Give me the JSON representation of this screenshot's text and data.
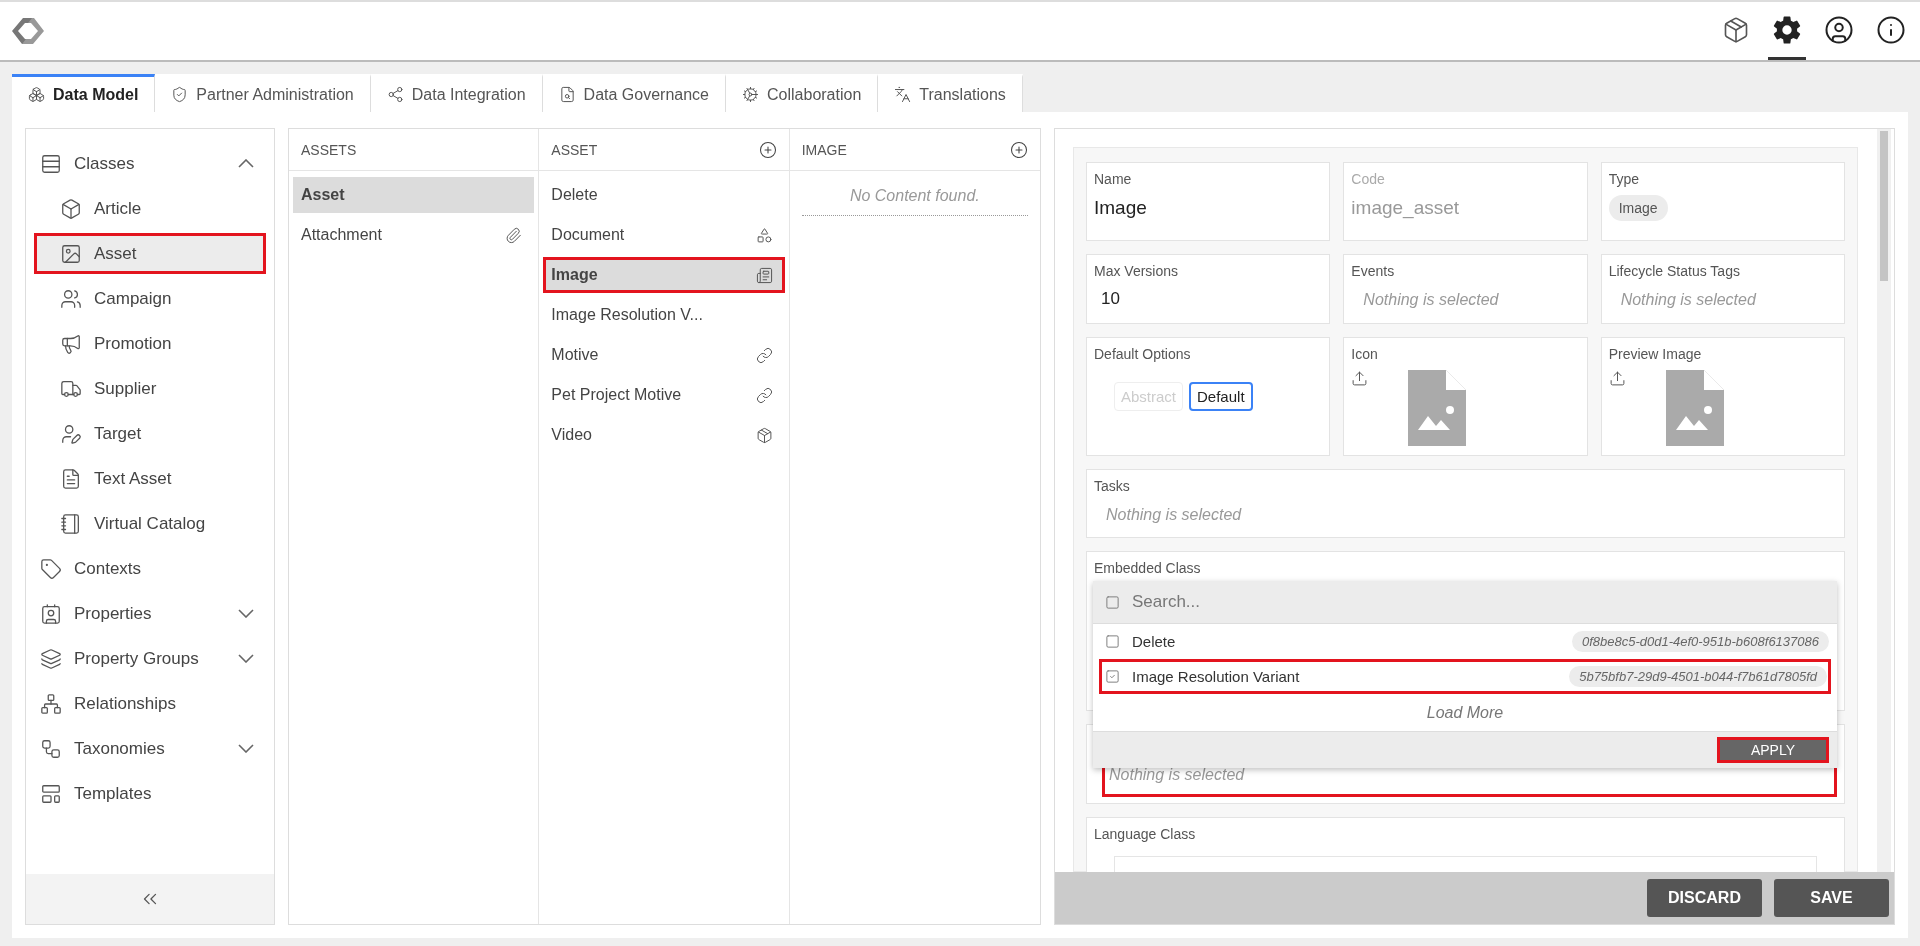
{
  "tabs": [
    {
      "label": "Data Model",
      "selected": true
    },
    {
      "label": "Partner Administration",
      "selected": false
    },
    {
      "label": "Data Integration",
      "selected": false
    },
    {
      "label": "Data Governance",
      "selected": false
    },
    {
      "label": "Collaboration",
      "selected": false
    },
    {
      "label": "Translations",
      "selected": false
    }
  ],
  "sidebar": {
    "items": [
      {
        "label": "Classes",
        "expanded": true,
        "selected": false,
        "children": [
          {
            "label": "Article",
            "selected": false,
            "highlighted": false
          },
          {
            "label": "Asset",
            "selected": true,
            "highlighted": true
          },
          {
            "label": "Campaign",
            "selected": false,
            "highlighted": false
          },
          {
            "label": "Promotion",
            "selected": false,
            "highlighted": false
          },
          {
            "label": "Supplier",
            "selected": false,
            "highlighted": false
          },
          {
            "label": "Target",
            "selected": false,
            "highlighted": false
          },
          {
            "label": "Text Asset",
            "selected": false,
            "highlighted": false
          },
          {
            "label": "Virtual Catalog",
            "selected": false,
            "highlighted": false
          }
        ]
      },
      {
        "label": "Contexts",
        "selected": false
      },
      {
        "label": "Properties",
        "expanded": false,
        "selected": false
      },
      {
        "label": "Property Groups",
        "expanded": false,
        "selected": false
      },
      {
        "label": "Relationships",
        "selected": false
      },
      {
        "label": "Taxonomies",
        "expanded": false,
        "selected": false
      },
      {
        "label": "Templates",
        "selected": false
      }
    ]
  },
  "columns": [
    {
      "title": "ASSETS",
      "items": [
        {
          "label": "Asset",
          "selected": true,
          "highlighted": false
        },
        {
          "label": "Attachment",
          "selected": false,
          "highlighted": false
        }
      ]
    },
    {
      "title": "ASSET",
      "items": [
        {
          "label": "Delete",
          "selected": false,
          "highlighted": false
        },
        {
          "label": "Document",
          "selected": false,
          "highlighted": false
        },
        {
          "label": "Image",
          "selected": true,
          "highlighted": true
        },
        {
          "label": "Image Resolution V...",
          "selected": false,
          "highlighted": false
        },
        {
          "label": "Motive",
          "selected": false,
          "highlighted": false
        },
        {
          "label": "Pet Project Motive",
          "selected": false,
          "highlighted": false
        },
        {
          "label": "Video",
          "selected": false,
          "highlighted": false
        }
      ]
    },
    {
      "title": "IMAGE",
      "empty_text": "No Content found."
    }
  ],
  "form": {
    "name": {
      "label": "Name",
      "value": "Image"
    },
    "code": {
      "label": "Code",
      "value": "image_asset",
      "disabled": true
    },
    "type": {
      "label": "Type",
      "chip": "Image"
    },
    "max_versions": {
      "label": "Max Versions",
      "value": "10"
    },
    "events": {
      "label": "Events",
      "empty_text": "Nothing is selected"
    },
    "lifecycle": {
      "label": "Lifecycle Status Tags",
      "empty_text": "Nothing is selected"
    },
    "default_options": {
      "label": "Default Options",
      "options": [
        {
          "label": "Abstract",
          "selected": false
        },
        {
          "label": "Default",
          "selected": true
        }
      ]
    },
    "icon": {
      "label": "Icon"
    },
    "preview_image": {
      "label": "Preview Image"
    },
    "tasks": {
      "label": "Tasks",
      "empty_text": "Nothing is selected"
    },
    "embedded_class": {
      "label": "Embedded Class"
    },
    "dropdown": {
      "search_placeholder": "Search...",
      "options": [
        {
          "label": "Delete",
          "id": "0f8be8c5-d0d1-4ef0-951b-b608f6137086",
          "checked": false,
          "highlighted": false
        },
        {
          "label": "Image Resolution Variant",
          "id": "5b75bfb7-29d9-4501-b044-f7b61d7805fd",
          "checked": true,
          "highlighted": true
        }
      ],
      "load_more": "Load More",
      "apply": "APPLY"
    },
    "hidden_field": {
      "empty_text": "Nothing is selected",
      "highlighted": true
    },
    "language_class": {
      "label": "Language Class"
    }
  },
  "actions": {
    "discard": "DISCARD",
    "save": "SAVE"
  }
}
